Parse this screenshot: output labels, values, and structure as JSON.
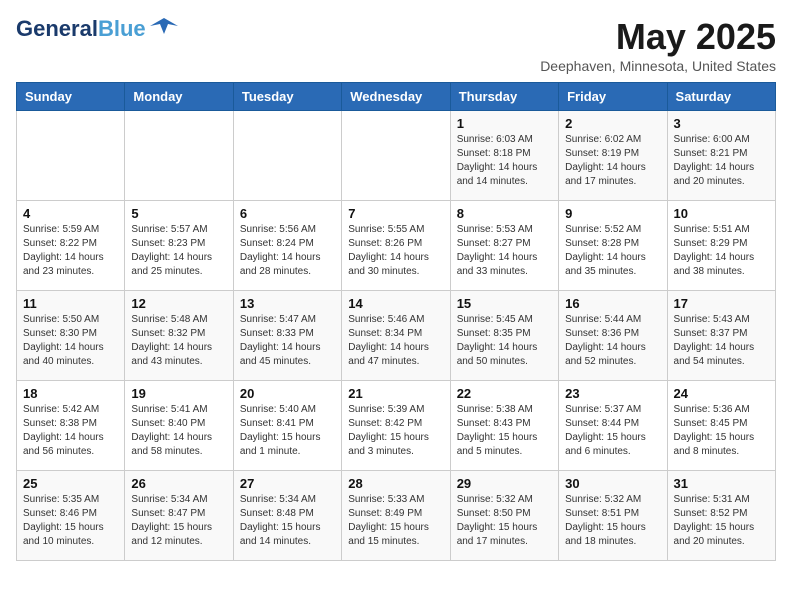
{
  "header": {
    "logo_general": "General",
    "logo_blue": "Blue",
    "month_title": "May 2025",
    "location": "Deephaven, Minnesota, United States"
  },
  "weekdays": [
    "Sunday",
    "Monday",
    "Tuesday",
    "Wednesday",
    "Thursday",
    "Friday",
    "Saturday"
  ],
  "weeks": [
    [
      {
        "day": "",
        "info": ""
      },
      {
        "day": "",
        "info": ""
      },
      {
        "day": "",
        "info": ""
      },
      {
        "day": "",
        "info": ""
      },
      {
        "day": "1",
        "info": "Sunrise: 6:03 AM\nSunset: 8:18 PM\nDaylight: 14 hours\nand 14 minutes."
      },
      {
        "day": "2",
        "info": "Sunrise: 6:02 AM\nSunset: 8:19 PM\nDaylight: 14 hours\nand 17 minutes."
      },
      {
        "day": "3",
        "info": "Sunrise: 6:00 AM\nSunset: 8:21 PM\nDaylight: 14 hours\nand 20 minutes."
      }
    ],
    [
      {
        "day": "4",
        "info": "Sunrise: 5:59 AM\nSunset: 8:22 PM\nDaylight: 14 hours\nand 23 minutes."
      },
      {
        "day": "5",
        "info": "Sunrise: 5:57 AM\nSunset: 8:23 PM\nDaylight: 14 hours\nand 25 minutes."
      },
      {
        "day": "6",
        "info": "Sunrise: 5:56 AM\nSunset: 8:24 PM\nDaylight: 14 hours\nand 28 minutes."
      },
      {
        "day": "7",
        "info": "Sunrise: 5:55 AM\nSunset: 8:26 PM\nDaylight: 14 hours\nand 30 minutes."
      },
      {
        "day": "8",
        "info": "Sunrise: 5:53 AM\nSunset: 8:27 PM\nDaylight: 14 hours\nand 33 minutes."
      },
      {
        "day": "9",
        "info": "Sunrise: 5:52 AM\nSunset: 8:28 PM\nDaylight: 14 hours\nand 35 minutes."
      },
      {
        "day": "10",
        "info": "Sunrise: 5:51 AM\nSunset: 8:29 PM\nDaylight: 14 hours\nand 38 minutes."
      }
    ],
    [
      {
        "day": "11",
        "info": "Sunrise: 5:50 AM\nSunset: 8:30 PM\nDaylight: 14 hours\nand 40 minutes."
      },
      {
        "day": "12",
        "info": "Sunrise: 5:48 AM\nSunset: 8:32 PM\nDaylight: 14 hours\nand 43 minutes."
      },
      {
        "day": "13",
        "info": "Sunrise: 5:47 AM\nSunset: 8:33 PM\nDaylight: 14 hours\nand 45 minutes."
      },
      {
        "day": "14",
        "info": "Sunrise: 5:46 AM\nSunset: 8:34 PM\nDaylight: 14 hours\nand 47 minutes."
      },
      {
        "day": "15",
        "info": "Sunrise: 5:45 AM\nSunset: 8:35 PM\nDaylight: 14 hours\nand 50 minutes."
      },
      {
        "day": "16",
        "info": "Sunrise: 5:44 AM\nSunset: 8:36 PM\nDaylight: 14 hours\nand 52 minutes."
      },
      {
        "day": "17",
        "info": "Sunrise: 5:43 AM\nSunset: 8:37 PM\nDaylight: 14 hours\nand 54 minutes."
      }
    ],
    [
      {
        "day": "18",
        "info": "Sunrise: 5:42 AM\nSunset: 8:38 PM\nDaylight: 14 hours\nand 56 minutes."
      },
      {
        "day": "19",
        "info": "Sunrise: 5:41 AM\nSunset: 8:40 PM\nDaylight: 14 hours\nand 58 minutes."
      },
      {
        "day": "20",
        "info": "Sunrise: 5:40 AM\nSunset: 8:41 PM\nDaylight: 15 hours\nand 1 minute."
      },
      {
        "day": "21",
        "info": "Sunrise: 5:39 AM\nSunset: 8:42 PM\nDaylight: 15 hours\nand 3 minutes."
      },
      {
        "day": "22",
        "info": "Sunrise: 5:38 AM\nSunset: 8:43 PM\nDaylight: 15 hours\nand 5 minutes."
      },
      {
        "day": "23",
        "info": "Sunrise: 5:37 AM\nSunset: 8:44 PM\nDaylight: 15 hours\nand 6 minutes."
      },
      {
        "day": "24",
        "info": "Sunrise: 5:36 AM\nSunset: 8:45 PM\nDaylight: 15 hours\nand 8 minutes."
      }
    ],
    [
      {
        "day": "25",
        "info": "Sunrise: 5:35 AM\nSunset: 8:46 PM\nDaylight: 15 hours\nand 10 minutes."
      },
      {
        "day": "26",
        "info": "Sunrise: 5:34 AM\nSunset: 8:47 PM\nDaylight: 15 hours\nand 12 minutes."
      },
      {
        "day": "27",
        "info": "Sunrise: 5:34 AM\nSunset: 8:48 PM\nDaylight: 15 hours\nand 14 minutes."
      },
      {
        "day": "28",
        "info": "Sunrise: 5:33 AM\nSunset: 8:49 PM\nDaylight: 15 hours\nand 15 minutes."
      },
      {
        "day": "29",
        "info": "Sunrise: 5:32 AM\nSunset: 8:50 PM\nDaylight: 15 hours\nand 17 minutes."
      },
      {
        "day": "30",
        "info": "Sunrise: 5:32 AM\nSunset: 8:51 PM\nDaylight: 15 hours\nand 18 minutes."
      },
      {
        "day": "31",
        "info": "Sunrise: 5:31 AM\nSunset: 8:52 PM\nDaylight: 15 hours\nand 20 minutes."
      }
    ]
  ]
}
